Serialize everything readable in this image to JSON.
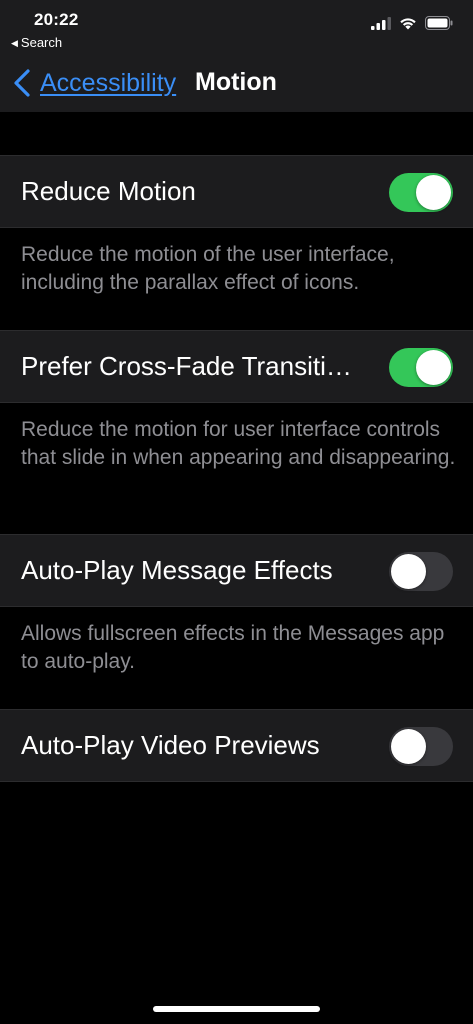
{
  "status_bar": {
    "time": "20:22",
    "back_app": "Search"
  },
  "nav": {
    "back_label": "Accessibility",
    "title": "Motion"
  },
  "settings": [
    {
      "label": "Reduce Motion",
      "enabled": true,
      "footnote": "Reduce the motion of the user interface, including the parallax effect of icons."
    },
    {
      "label": "Prefer Cross-Fade Transitions",
      "enabled": true,
      "footnote": "Reduce the motion for user interface controls that slide in when appearing and disappearing."
    },
    {
      "label": "Auto-Play Message Effects",
      "enabled": false,
      "footnote": "Allows fullscreen effects in the Messages app to auto-play."
    },
    {
      "label": "Auto-Play Video Previews",
      "enabled": false
    }
  ],
  "colors": {
    "accent": "#3a8ef6",
    "toggle_on": "#34c759",
    "toggle_off": "#39393d",
    "row_background": "#1c1c1e",
    "footnote_text": "#8e8e93"
  },
  "icons": [
    "back-triangle-icon",
    "cellular-signal-icon",
    "wifi-icon",
    "battery-icon",
    "chevron-left-icon"
  ]
}
